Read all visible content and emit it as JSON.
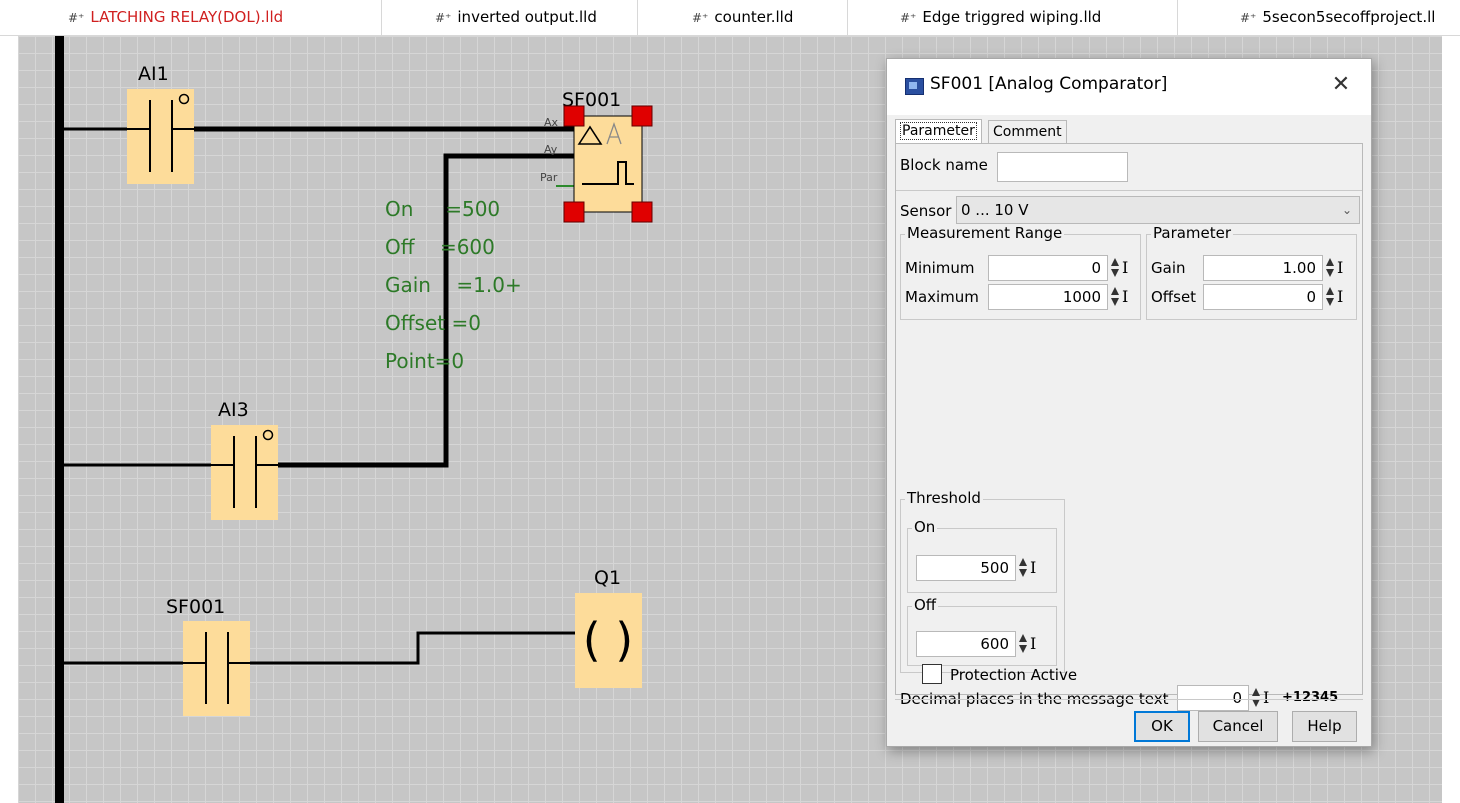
{
  "tabs": [
    {
      "label": "LATCHING RELAY(DOL).lld",
      "active": true,
      "color": "#d02020"
    },
    {
      "label": "inverted output.lld"
    },
    {
      "label": "counter.lld"
    },
    {
      "label": "Edge triggred wiping.lld"
    },
    {
      "label": "5secon5secoffproject.ll"
    }
  ],
  "tab_icon": "#⁺",
  "diagram": {
    "contact_ai1": "AI1",
    "contact_ai3": "AI3",
    "contact_sf001": "SF001",
    "block_sf001": "SF001",
    "pin_ax": "Ax",
    "pin_ay": "Ay",
    "pin_par": "Par",
    "coil_q1": "Q1",
    "coil_symbol": "( )",
    "params": [
      "On     =500",
      "Off    =600",
      "Gain    =1.0+",
      "Offset =0",
      "Point=0"
    ],
    "element_fill": "#fddc9a",
    "selection_color": "#e00000",
    "param_text_color": "#2d7a28"
  },
  "dialog": {
    "title": "SF001 [Analog Comparator]",
    "close_glyph": "✕",
    "tabs": [
      "Parameter",
      "Comment"
    ],
    "block_name_label": "Block name",
    "block_name_value": "",
    "sensor_label": "Sensor",
    "sensor_value": "0 ... 10 V",
    "measurement_range": {
      "title": "Measurement Range",
      "minimum_label": "Minimum",
      "minimum_value": "0",
      "maximum_label": "Maximum",
      "maximum_value": "1000"
    },
    "parameter": {
      "title": "Parameter",
      "gain_label": "Gain",
      "gain_value": "1.00",
      "offset_label": "Offset",
      "offset_value": "0"
    },
    "threshold": {
      "title": "Threshold",
      "on_label": "On",
      "on_value": "500",
      "off_label": "Off",
      "off_value": "600"
    },
    "decimal_label": "Decimal places in the message text",
    "decimal_value": "0",
    "decimal_preview": "+12345",
    "protection_label": "Protection Active",
    "ibeam": "I",
    "buttons": {
      "ok": "OK",
      "cancel": "Cancel",
      "help": "Help"
    }
  }
}
